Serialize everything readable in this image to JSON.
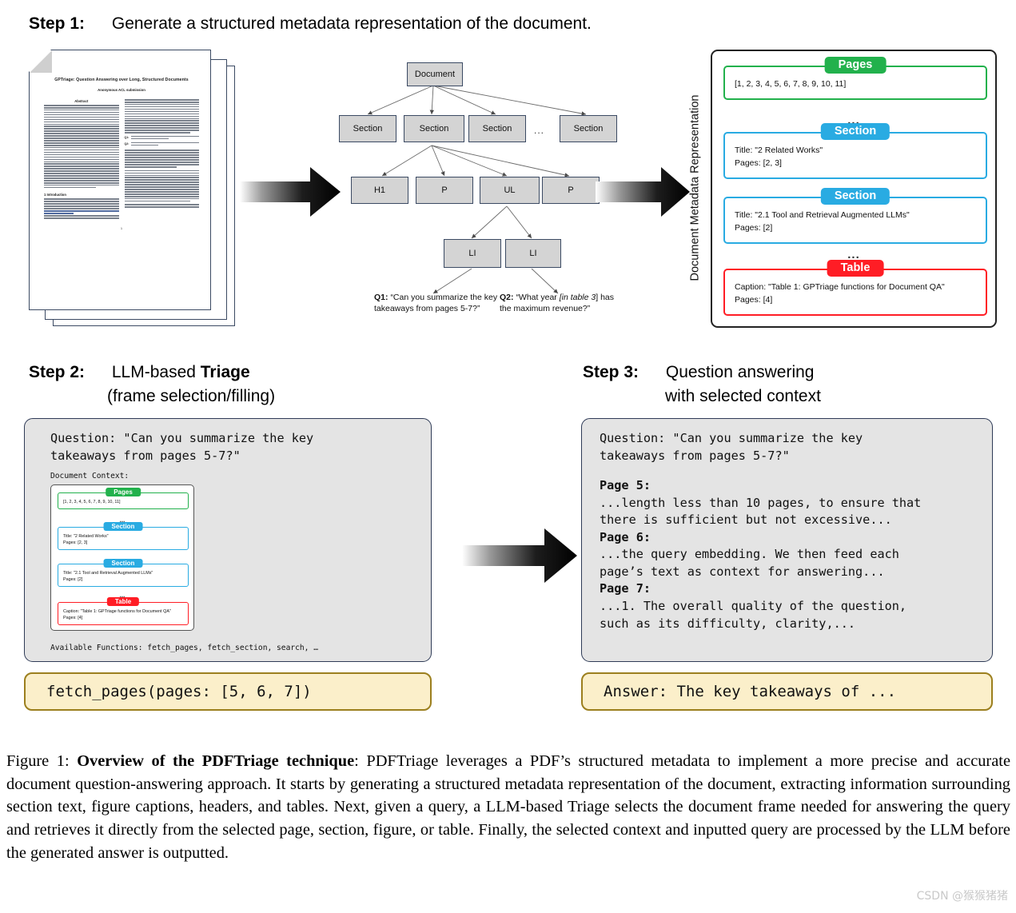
{
  "steps": {
    "step1": {
      "label": "Step 1:",
      "text": "Generate a structured metadata representation of the document."
    },
    "step2": {
      "label": "Step 2:",
      "text_pre": "LLM-based ",
      "text_bold": "Triage",
      "text_line2": "(frame selection/filling)"
    },
    "step3": {
      "label": "Step 3:",
      "text_line1": "Question answering",
      "text_line2": "with selected context"
    }
  },
  "document_preview": {
    "title": "GPTriage: Question Answering over Long, Structured Documents",
    "authors": "Anonymous ACL submission",
    "abstract_heading": "Abstract",
    "intro_heading": "1   Introduction",
    "q1_tag": "Q1:",
    "q1_text": "\"Can you summarize the key takeaways from pages 5-7?\"",
    "q2_tag": "Q2:",
    "q2_text": "\"What year [in table 3] has the maximum revenue?\"",
    "page_number": "1"
  },
  "tree": {
    "root": "Document",
    "level1": [
      "Section",
      "Section",
      "Section",
      "Section"
    ],
    "level1_ellipsis": "...",
    "level2": [
      "H1",
      "P",
      "UL",
      "P"
    ],
    "level3": [
      "LI",
      "LI"
    ],
    "questions": [
      {
        "tag": "Q1:",
        "pre": "“Can you summarize the key takeaways from pages 5-7?”"
      },
      {
        "tag": "Q2:",
        "pre": "“What year ",
        "em": "[in table 3",
        "post": "] has the maximum revenue?”"
      }
    ]
  },
  "metadata_representation": {
    "vertical_label": "Document Metadata Representation",
    "ellipsis": "...",
    "frames": [
      {
        "badge": "Pages",
        "color": "#22b14c",
        "lines": [
          "[1, 2, 3, 4, 5, 6, 7, 8, 9, 10, 11]"
        ]
      },
      {
        "badge": "Section",
        "color": "#29abe2",
        "lines": [
          "Title: \"2 Related Works\"",
          "Pages: [2, 3]"
        ]
      },
      {
        "badge": "Section",
        "color": "#29abe2",
        "lines": [
          "Title: \"2.1 Tool and Retrieval Augmented LLMs\"",
          "Pages: [2]"
        ]
      },
      {
        "badge": "Table",
        "color": "#ff1d25",
        "lines": [
          "Caption: \"Table 1: GPTriage functions for Document QA\"",
          "Pages: [4]"
        ]
      }
    ]
  },
  "step2_panel": {
    "question": "Question: \"Can you summarize the key\ntakeaways from pages 5-7?\"",
    "context_label": "Document Context:",
    "available_functions": "Available Functions: fetch_pages, fetch_section, search, …",
    "output": "fetch_pages(pages: [5, 6, 7])"
  },
  "step3_panel": {
    "question": "Question: \"Can you summarize the key\ntakeaways from pages 5-7?\"",
    "pages": [
      {
        "heading": "Page 5:",
        "body": "...length less than 10 pages, to ensure that\nthere is sufficient but not excessive..."
      },
      {
        "heading": "Page 6:",
        "body": "...the query embedding. We then feed each\npage’s text as context for answering..."
      },
      {
        "heading": "Page 7:",
        "body": "...1. The overall quality of the question,\nsuch as its difficulty, clarity,..."
      }
    ],
    "output": "Answer: The key takeaways of ..."
  },
  "caption": {
    "prefix": "Figure 1: ",
    "bold": "Overview of the PDFTriage technique",
    "rest": ": PDFTriage leverages a PDF’s structured metadata to implement a more precise and accurate document question-answering approach. It starts by generating a structured metadata representation of the document, extracting information surrounding section text, figure captions, headers, and tables. Next, given a query, a LLM-based Triage selects the document frame needed for answering the query and retrieves it directly from the selected page, section, figure, or table.  Finally, the selected context and inputted query are processed by the LLM before the generated answer is outputted."
  },
  "watermark": "CSDN @猴猴猪猪"
}
